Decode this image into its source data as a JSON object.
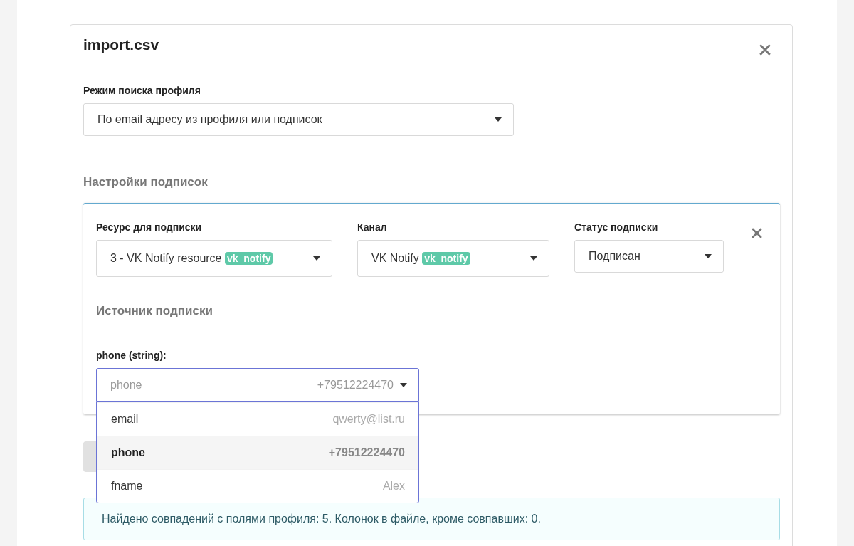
{
  "dialog": {
    "title": "import.csv"
  },
  "profile_search": {
    "label": "Режим поиска профиля",
    "value": "По email адресу из профиля или подписок"
  },
  "subscriptions": {
    "heading": "Настройки подписок",
    "resource": {
      "label": "Ресурс для подписки",
      "value": "3 - VK Notify resource",
      "tag": "vk_notify"
    },
    "channel": {
      "label": "Канал",
      "value": "VK Notify",
      "tag": "vk_notify"
    },
    "status": {
      "label": "Статус подписки",
      "value": "Подписан"
    },
    "source": {
      "heading": "Источник подписки",
      "field_label": "phone (string):",
      "value": "phone",
      "sample": "+79512224470",
      "expanded": true,
      "options": [
        {
          "name": "email",
          "sample": "qwerty@list.ru",
          "selected": false
        },
        {
          "name": "phone",
          "sample": "+79512224470",
          "selected": true
        },
        {
          "name": "fname",
          "sample": "Alex",
          "selected": false
        }
      ]
    }
  },
  "info": "Найдено совпадений с полями профиля: 5. Колонок в файле, кроме совпавших: 0."
}
